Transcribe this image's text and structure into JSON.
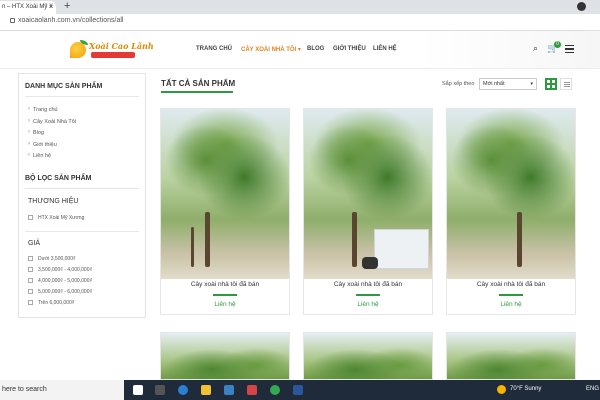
{
  "browser": {
    "tab_title": "n – HTX Xoài Mỹ X",
    "tab_close": "×",
    "new_tab": "+",
    "url": "xoaicaolanh.com.vn/collections/all"
  },
  "site": {
    "logo_text": "Xoài Cao Lãnh",
    "nav": [
      {
        "label": "TRANG CHỦ"
      },
      {
        "label": "CÂY XOÀI NHÀ TÔI ▾"
      },
      {
        "label": "BLOG"
      },
      {
        "label": "GIỚI THIỆU"
      },
      {
        "label": "LIÊN HỆ"
      }
    ],
    "cart_count": "0",
    "accent": "#2e9a3f",
    "highlight": "#e2821f"
  },
  "sidebar": {
    "categories_title": "DANH MỤC SẢN PHẨM",
    "categories": [
      "Trang chủ",
      "Cây Xoài Nhà Tôi",
      "Blog",
      "Giới thiệu",
      "Liên hệ"
    ],
    "filter_title": "BỘ LỌC SẢN PHẨM",
    "brand_title": "THƯƠNG HIỆU",
    "brands": [
      "HTX Xoài Mỹ Xương"
    ],
    "price_title": "GIÁ",
    "prices": [
      "Dưới 3,500,000₫",
      "3,500,000₫ - 4,000,000₫",
      "4,000,000₫ - 5,000,000₫",
      "5,000,000₫ - 6,000,000₫",
      "Trên 6,000,000₫"
    ]
  },
  "main": {
    "title": "TẤT CẢ SẢN PHẨM",
    "sort_label": "Sắp xếp theo",
    "sort_value": "Mới nhất",
    "products": [
      {
        "name": "Cây xoài nhà tôi đã bán",
        "link": "Liên hệ"
      },
      {
        "name": "Cây xoài nhà tôi đã bán",
        "link": "Liên hệ"
      },
      {
        "name": "Cây xoài nhà tôi đã bán",
        "link": "Liên hệ"
      }
    ]
  },
  "taskbar": {
    "search_text": "here to search",
    "weather": "70°F  Sunny",
    "lang": "ENG"
  }
}
